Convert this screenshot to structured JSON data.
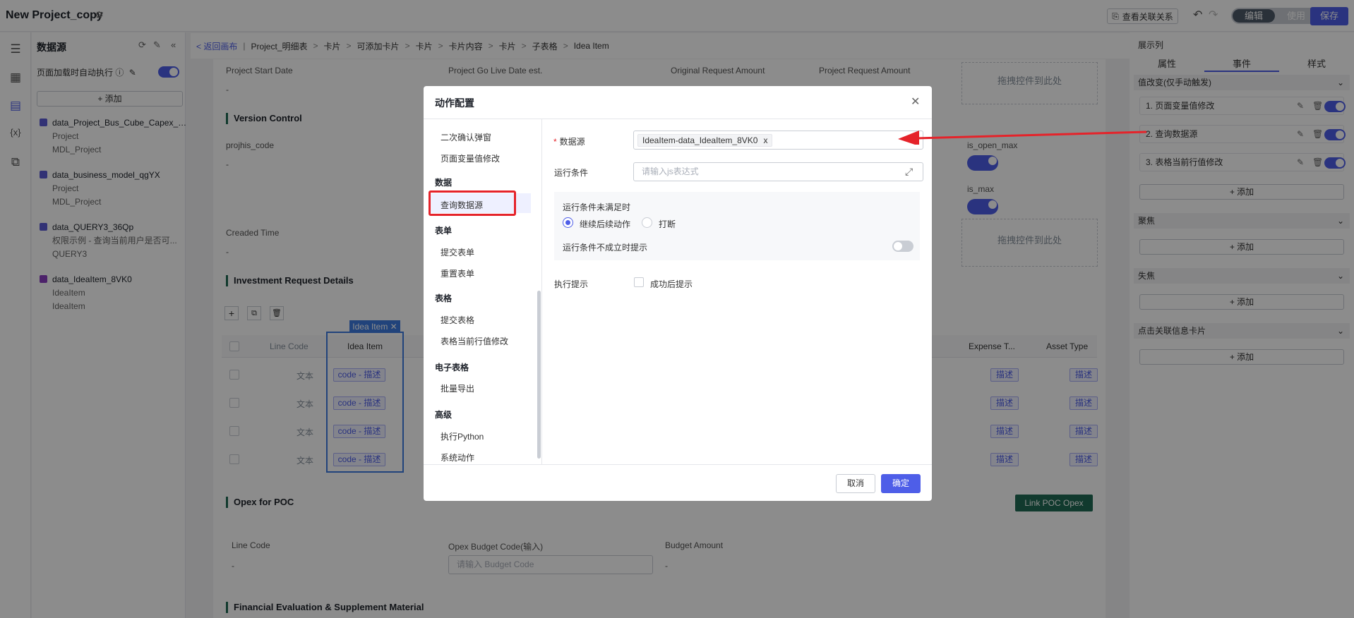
{
  "app": {
    "title": "New Project_copy",
    "rel_btn": "查看关联关系",
    "mode_edit": "编辑",
    "mode_use": "使用",
    "save": "保存"
  },
  "datasource": {
    "title": "数据源",
    "auto_exec": "页面加载时自动执行",
    "add": "+ 添加",
    "items": [
      {
        "name": "data_Project_Bus_Cube_Capex_X2...",
        "sub1": "Project",
        "sub2": "MDL_Project"
      },
      {
        "name": "data_business_model_qgYX",
        "sub1": "Project",
        "sub2": "MDL_Project"
      },
      {
        "name": "data_QUERY3_36Qp",
        "sub1": "权限示例 - 查询当前用户是否可...",
        "sub2": "QUERY3"
      },
      {
        "name": "data_IdeaItem_8VK0",
        "sub1": "IdeaItem",
        "sub2": "IdeaItem"
      }
    ]
  },
  "breadcrumb": [
    "Project_明细表",
    "卡片",
    "可添加卡片",
    "卡片",
    "卡片内容",
    "卡片",
    "子表格",
    "Idea Item"
  ],
  "breadcrumb_back": "< 返回画布",
  "canvas": {
    "project_start_date": "Project Start Date",
    "go_live": "Project Go Live Date est.",
    "original_request": "Original Request Amount",
    "project_request": "Project Request Amount",
    "dropzone": "拖拽控件到此处",
    "version_control": "Version Control",
    "projhis_code": "projhis_code",
    "created_time": "Creaded Time",
    "is_open_max": "is_open_max",
    "is_max": "is_max",
    "dash": "-",
    "investment": "Investment Request Details",
    "cols": {
      "line_code": "Line Code",
      "idea_item": "Idea Item",
      "expense": "Expense T...",
      "asset": "Asset Type"
    },
    "idea_tag": "Idea Item",
    "cell_text": "文本",
    "cell_code": "code - 描述",
    "cell_desc": "描述",
    "opex_poc": "Opex for POC",
    "link_poc": "Link POC Opex",
    "opex_line_code": "Line Code",
    "opex_budget_code": "Opex Budget Code(输入)",
    "opex_budget_amount": "Budget Amount",
    "opex_placeholder": "请输入 Budget Code",
    "financial": "Financial Evaluation & Supplement Material"
  },
  "right_panel": {
    "title": "展示列",
    "tabs": [
      "属性",
      "事件",
      "样式"
    ],
    "sections": [
      {
        "title": "值改变(仅手动触发)",
        "rows": [
          "1. 页面变量值修改",
          "2. 查询数据源",
          "3. 表格当前行值修改"
        ]
      },
      {
        "title": "聚焦",
        "rows": []
      },
      {
        "title": "失焦",
        "rows": []
      },
      {
        "title": "点击关联信息卡片",
        "rows": []
      }
    ],
    "add": "+ 添加"
  },
  "modal": {
    "title": "动作配置",
    "actions": [
      {
        "type": "item",
        "label": "二次确认弹窗"
      },
      {
        "type": "item",
        "label": "页面变量值修改"
      },
      {
        "type": "group",
        "label": "数据"
      },
      {
        "type": "item",
        "label": "查询数据源"
      },
      {
        "type": "group",
        "label": "表单"
      },
      {
        "type": "item",
        "label": "提交表单"
      },
      {
        "type": "item",
        "label": "重置表单"
      },
      {
        "type": "group",
        "label": "表格"
      },
      {
        "type": "item",
        "label": "提交表格"
      },
      {
        "type": "item",
        "label": "表格当前行值修改"
      },
      {
        "type": "group",
        "label": "电子表格"
      },
      {
        "type": "item",
        "label": "批量导出"
      },
      {
        "type": "group",
        "label": "高级"
      },
      {
        "type": "item",
        "label": "执行Python"
      },
      {
        "type": "item",
        "label": "系统动作"
      }
    ],
    "form": {
      "ds_label": "数据源",
      "ds_value": "IdeaItem-data_IdeaItem_8VK0",
      "cond_label": "运行条件",
      "cond_placeholder": "请输入js表达式",
      "unmet_title": "运行条件未满足时",
      "opt_continue": "继续后续动作",
      "opt_break": "打断",
      "unmet_tip": "运行条件不成立时提示",
      "exec_tip_label": "执行提示",
      "exec_tip_opt": "成功后提示"
    },
    "cancel": "取消",
    "ok": "确定"
  },
  "colors": {
    "primary": "#4e5ee8",
    "highlight": "#e5232a",
    "green": "#1f6b54"
  }
}
